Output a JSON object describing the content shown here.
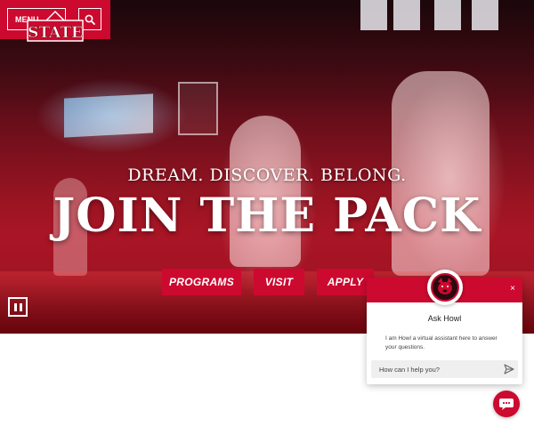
{
  "header": {
    "menu_label": "MENU",
    "logo_text": "STATE",
    "icons": {
      "search": "search-icon"
    }
  },
  "hero": {
    "tagline": "DREAM. DISCOVER. BELONG.",
    "headline": "JOIN THE PACK",
    "buttons": [
      {
        "label": "PROGRAMS"
      },
      {
        "label": "VISIT"
      },
      {
        "label": "APPLY"
      }
    ],
    "pause_icon": "pause-icon"
  },
  "chat": {
    "title": "Ask Howl",
    "message": "I am Howl a virtual assistant here to answer your questions.",
    "input_placeholder": "How can I help you?",
    "close_label": "×",
    "icons": {
      "send": "send-icon",
      "avatar": "howl-avatar",
      "fab": "chat-bubble-icon"
    }
  },
  "colors": {
    "brand_red": "#cc092f",
    "white": "#ffffff"
  }
}
